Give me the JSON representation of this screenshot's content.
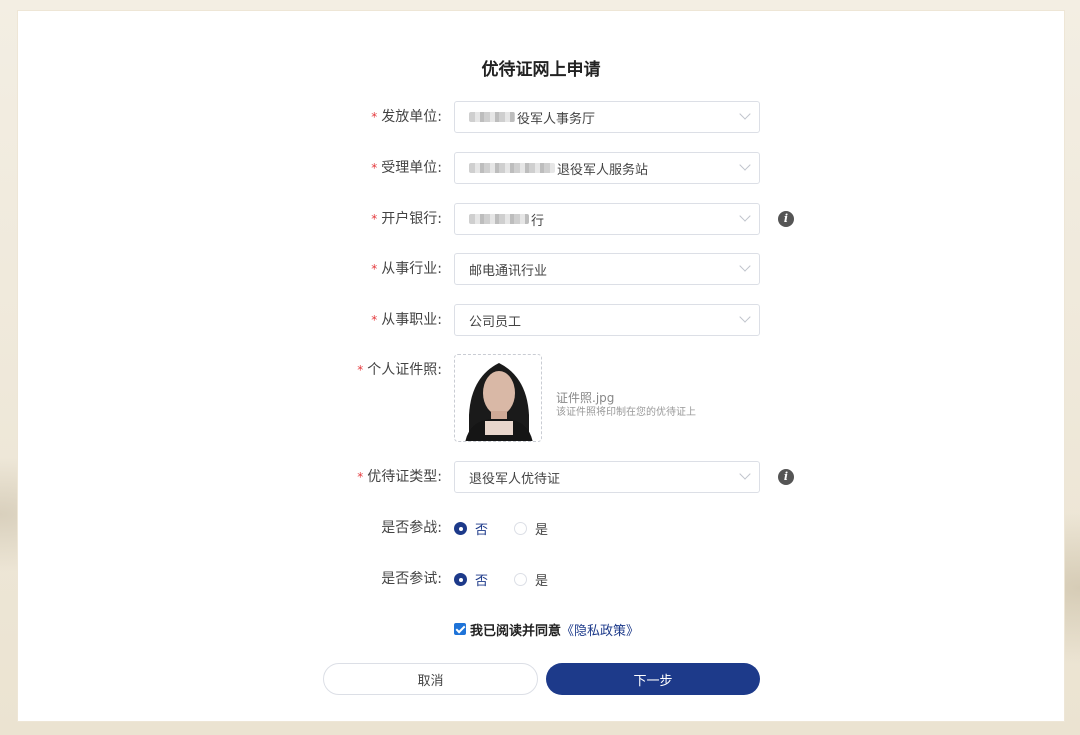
{
  "form": {
    "title": "优待证网上申请",
    "fields": {
      "issuer": {
        "label": "发放单位:",
        "value": "役军人事务厅"
      },
      "acceptor": {
        "label": "受理单位:",
        "value": "退役军人服务站"
      },
      "bank": {
        "label": "开户银行:",
        "value": "行"
      },
      "industry": {
        "label": "从事行业:",
        "value": "邮电通讯行业"
      },
      "occupation": {
        "label": "从事职业:",
        "value": "公司员工"
      },
      "photo": {
        "label": "个人证件照:",
        "file_name": "证件照.jpg",
        "hint": "该证件照将印制在您的优待证上"
      },
      "card_type": {
        "label": "优待证类型:",
        "value": "退役军人优待证"
      },
      "combat": {
        "label": "是否参战:",
        "options": [
          "否",
          "是"
        ],
        "selected": "否"
      },
      "test": {
        "label": "是否参试:",
        "options": [
          "否",
          "是"
        ],
        "selected": "否"
      }
    },
    "required_mark": "*",
    "info_icon": "i",
    "agreement": {
      "text": "我已阅读并同意",
      "link": "《隐私政策》",
      "checked": true
    },
    "buttons": {
      "cancel": "取消",
      "next": "下一步"
    }
  },
  "colors": {
    "accent": "#1d3a8a",
    "required": "#e4393c",
    "checkbox": "#1e73d8"
  }
}
